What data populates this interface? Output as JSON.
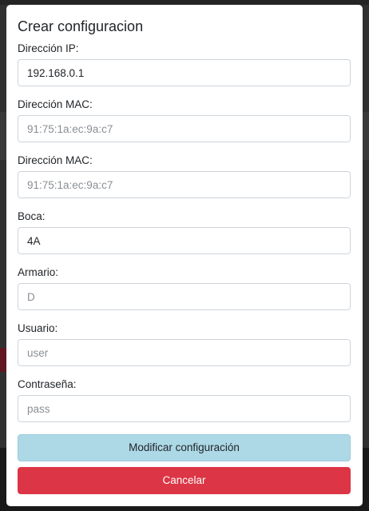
{
  "modal": {
    "title": "Crear configuracion",
    "fields": [
      {
        "label": "Dirección IP:",
        "value": "192.168.0.1",
        "placeholder": ""
      },
      {
        "label": "Dirección MAC:",
        "value": "",
        "placeholder": "91:75:1a:ec:9a:c7"
      },
      {
        "label": "Dirección MAC:",
        "value": "",
        "placeholder": "91:75:1a:ec:9a:c7"
      },
      {
        "label": "Boca:",
        "value": "4A",
        "placeholder": ""
      },
      {
        "label": "Armario:",
        "value": "",
        "placeholder": "D"
      },
      {
        "label": "Usuario:",
        "value": "",
        "placeholder": "user"
      },
      {
        "label": "Contraseña:",
        "value": "",
        "placeholder": "pass"
      }
    ],
    "modify_label": "Modificar configuración",
    "cancel_label": "Cancelar"
  },
  "colors": {
    "modify_button_bg": "#add8e6",
    "cancel_button_bg": "#dc3545"
  }
}
